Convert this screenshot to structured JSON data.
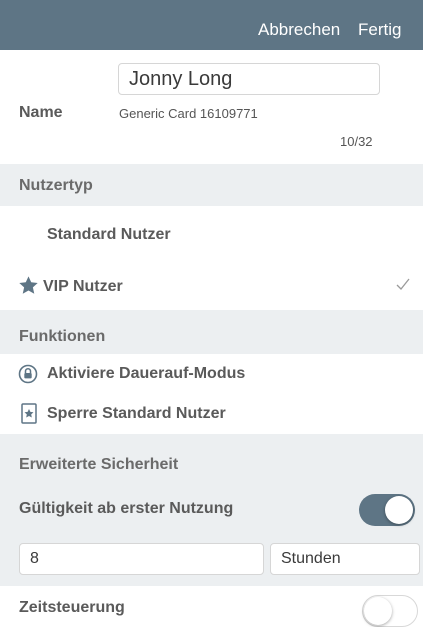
{
  "topbar": {
    "cancel": "Abbrechen",
    "done": "Fertig"
  },
  "name": {
    "label": "Name",
    "value": "Jonny Long",
    "subtitle": "Generic Card 16109771",
    "counter": "10/32"
  },
  "user_type": {
    "header": "Nutzertyp",
    "options": [
      {
        "label": "Standard Nutzer",
        "selected": false
      },
      {
        "label": "VIP Nutzer",
        "icon": "star-icon",
        "selected": true
      }
    ]
  },
  "functions": {
    "header": "Funktionen",
    "items": [
      {
        "label": "Aktiviere Dauerauf-Modus",
        "icon": "lock-circle-icon"
      },
      {
        "label": "Sperre Standard Nutzer",
        "icon": "star-card-icon"
      }
    ]
  },
  "security": {
    "header": "Erweiterte Sicherheit",
    "validity_label": "Gültigkeit ab erster Nutzung",
    "validity_enabled": true,
    "duration_value": "8",
    "duration_unit": "Stunden",
    "schedule_label": "Zeitsteuerung",
    "schedule_enabled": false
  },
  "colors": {
    "accent": "#5e7585",
    "section_bg": "#eceff1"
  }
}
